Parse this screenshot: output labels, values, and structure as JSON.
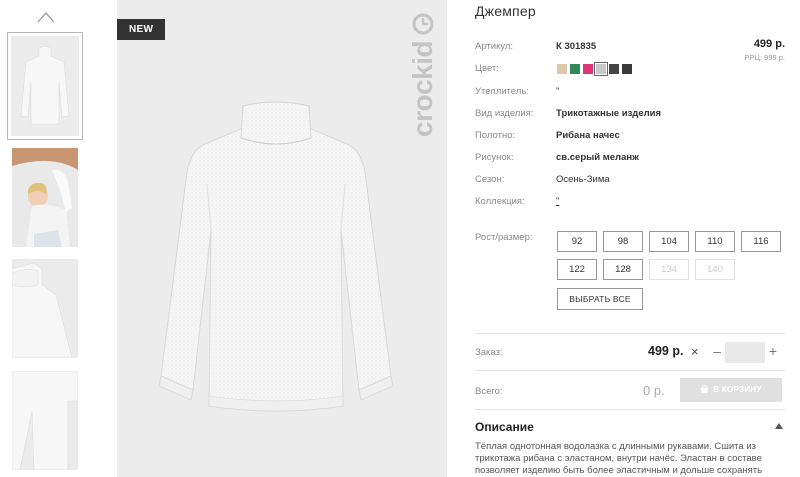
{
  "badge": "NEW",
  "brand": "crockid",
  "product": {
    "title": "Джемпер",
    "price": "499 р.",
    "rrc": "РРЦ: 999 р.",
    "attributes": [
      {
        "label": "Артикул:",
        "value": "К 301835",
        "bold": true
      },
      {
        "label": "Цвет:",
        "value": "",
        "bold": true
      },
      {
        "label": "Утеплитель:",
        "value": "\"",
        "bold": false
      },
      {
        "label": "Вид изделия:",
        "value": "Трикотажные изделия",
        "bold": true
      },
      {
        "label": "Полотно:",
        "value": "Рибана начес",
        "bold": true
      },
      {
        "label": "Рисунок:",
        "value": "св.серый меланж",
        "bold": true
      },
      {
        "label": "Сезон:",
        "value": "Осень-Зима",
        "bold": false
      },
      {
        "label": "Коллекция:",
        "value": "\"",
        "bold": false
      }
    ],
    "colors": [
      "#d9c9a8",
      "#2e8b57",
      "#e0337a",
      "#c8c8c8",
      "#444444",
      "#3a3a3a"
    ],
    "selected_color_index": 3,
    "size_label": "Рост/размер:",
    "sizes": [
      {
        "label": "92",
        "available": true
      },
      {
        "label": "98",
        "available": true
      },
      {
        "label": "104",
        "available": true
      },
      {
        "label": "110",
        "available": true
      },
      {
        "label": "116",
        "available": true
      },
      {
        "label": "122",
        "available": true
      },
      {
        "label": "128",
        "available": true
      },
      {
        "label": "134",
        "available": false
      },
      {
        "label": "140",
        "available": false
      }
    ],
    "select_all": "ВЫБРАТЬ ВСЕ"
  },
  "order": {
    "label": "Заказ:",
    "price": "499 р.",
    "times": "×",
    "minus": "–",
    "plus": "+",
    "quantity": ""
  },
  "total": {
    "label": "Всего:",
    "value": "0 р.",
    "cart_button": "В КОРЗИНУ"
  },
  "description": {
    "title": "Описание",
    "text": "Тёплая однотонная водолазка с длинными рукавами. Сшита из трикотажа рибана с эластаном, внутри начёс. Эластан в составе позволяет изделию быть более эластичным и дольше сохранять"
  }
}
